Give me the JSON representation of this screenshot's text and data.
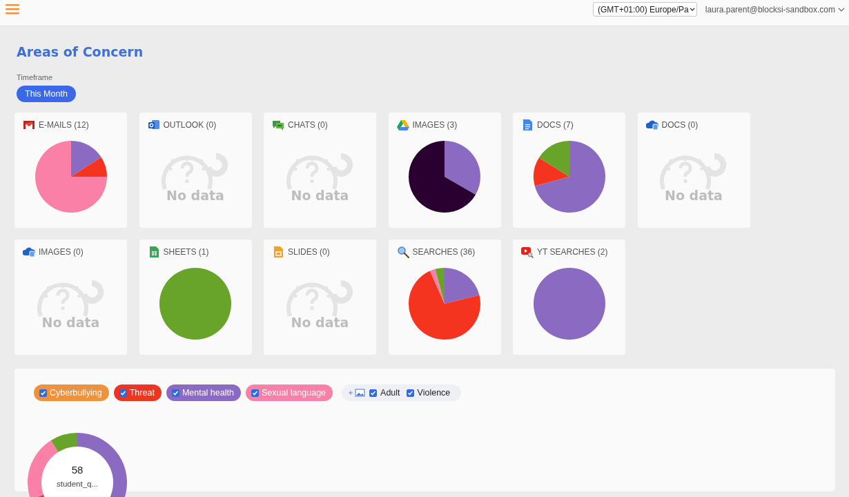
{
  "header": {
    "timezone": "(GMT+01:00) Europe/Pa",
    "user": "laura.parent@blocksi-sandbox.com"
  },
  "title": "Areas of Concern",
  "timeframe": {
    "label": "Timeframe",
    "value": "This Month"
  },
  "cards": [
    {
      "title": "E-MAILS (12)",
      "kind": "pie"
    },
    {
      "title": "OUTLOOK (0)",
      "kind": "empty",
      "empty_text": "No data"
    },
    {
      "title": "CHATS (0)",
      "kind": "empty",
      "empty_text": "No data"
    },
    {
      "title": "IMAGES (3)",
      "kind": "pie"
    },
    {
      "title": "DOCS (7)",
      "kind": "pie"
    },
    {
      "title": "DOCS (0)",
      "kind": "empty",
      "empty_text": "No data"
    },
    {
      "title": "IMAGES (0)",
      "kind": "empty",
      "empty_text": "No data"
    },
    {
      "title": "SHEETS (1)",
      "kind": "pie"
    },
    {
      "title": "SLIDES (0)",
      "kind": "empty",
      "empty_text": "No data"
    },
    {
      "title": "SEARCHES (36)",
      "kind": "pie"
    },
    {
      "title": "YT SEARCHES (2)",
      "kind": "pie"
    }
  ],
  "legend": [
    {
      "label": "Cyberbullying",
      "checked": true,
      "color": "#f0913c"
    },
    {
      "label": "Threat",
      "checked": true,
      "color": "#ee3524"
    },
    {
      "label": "Mental health",
      "checked": true,
      "color": "#8a6bc1"
    },
    {
      "label": "Sexual language",
      "checked": true,
      "color": "#fb80a8"
    }
  ],
  "image_filters": [
    {
      "label": "Adult",
      "checked": true
    },
    {
      "label": "Violence",
      "checked": true
    }
  ],
  "donut": {
    "total": "58",
    "label": "student_q..."
  }
}
